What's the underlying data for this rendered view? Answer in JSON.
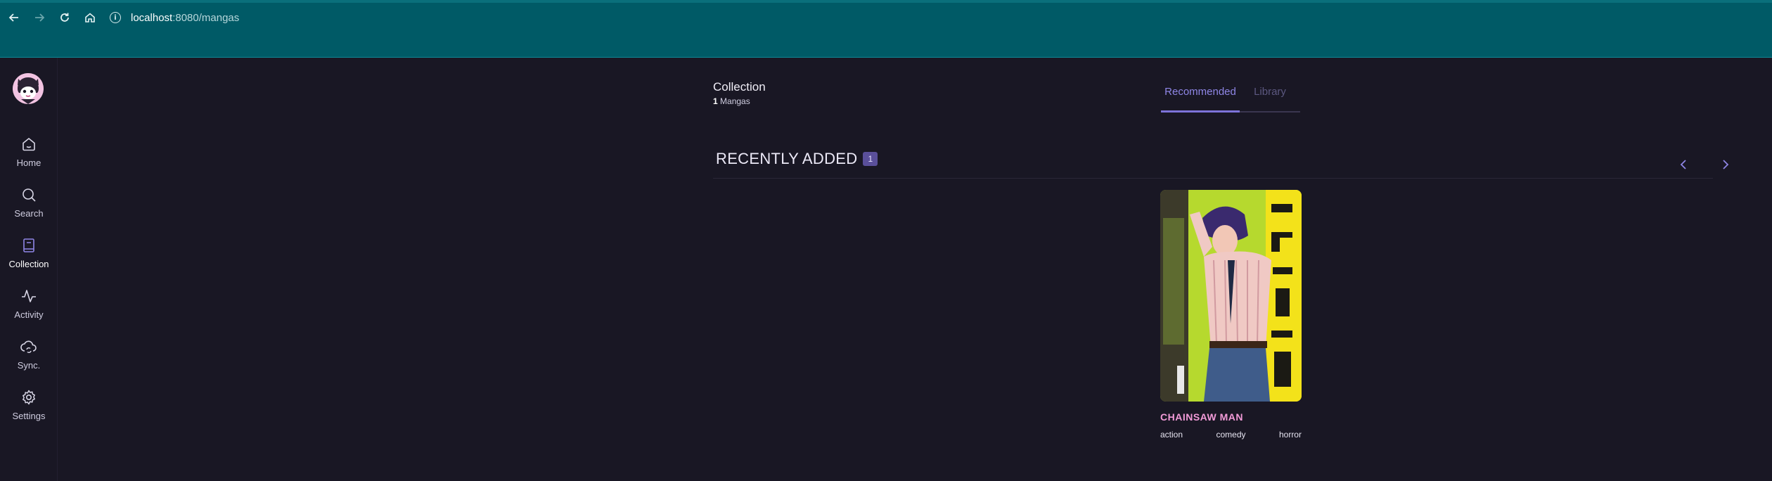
{
  "browser": {
    "url_host": "localhost",
    "url_path": ":8080/mangas",
    "icons": [
      "back-arrow-icon",
      "forward-arrow-icon",
      "reload-icon",
      "home-icon",
      "site-info-icon"
    ]
  },
  "sidebar": {
    "items": [
      {
        "label": "Home",
        "icon": "home-icon"
      },
      {
        "label": "Search",
        "icon": "search-icon"
      },
      {
        "label": "Collection",
        "icon": "book-icon",
        "active": true
      },
      {
        "label": "Activity",
        "icon": "activity-icon"
      },
      {
        "label": "Sync.",
        "icon": "cloud-sync-icon"
      },
      {
        "label": "Settings",
        "icon": "gear-icon"
      }
    ]
  },
  "header": {
    "title": "Collection",
    "count": "1",
    "count_label": "Mangas"
  },
  "tabs": [
    {
      "label": "Recommended",
      "active": true
    },
    {
      "label": "Library",
      "active": false
    }
  ],
  "section": {
    "title": "RECENTLY ADDED",
    "badge": "1"
  },
  "manga": {
    "title": "CHAINSAW MAN",
    "tags": [
      "action",
      "comedy",
      "horror"
    ]
  },
  "colors": {
    "background": "#191724",
    "browser_chrome": "#005a66",
    "accent": "#8f86e6",
    "manga_title": "#f29bd8"
  }
}
